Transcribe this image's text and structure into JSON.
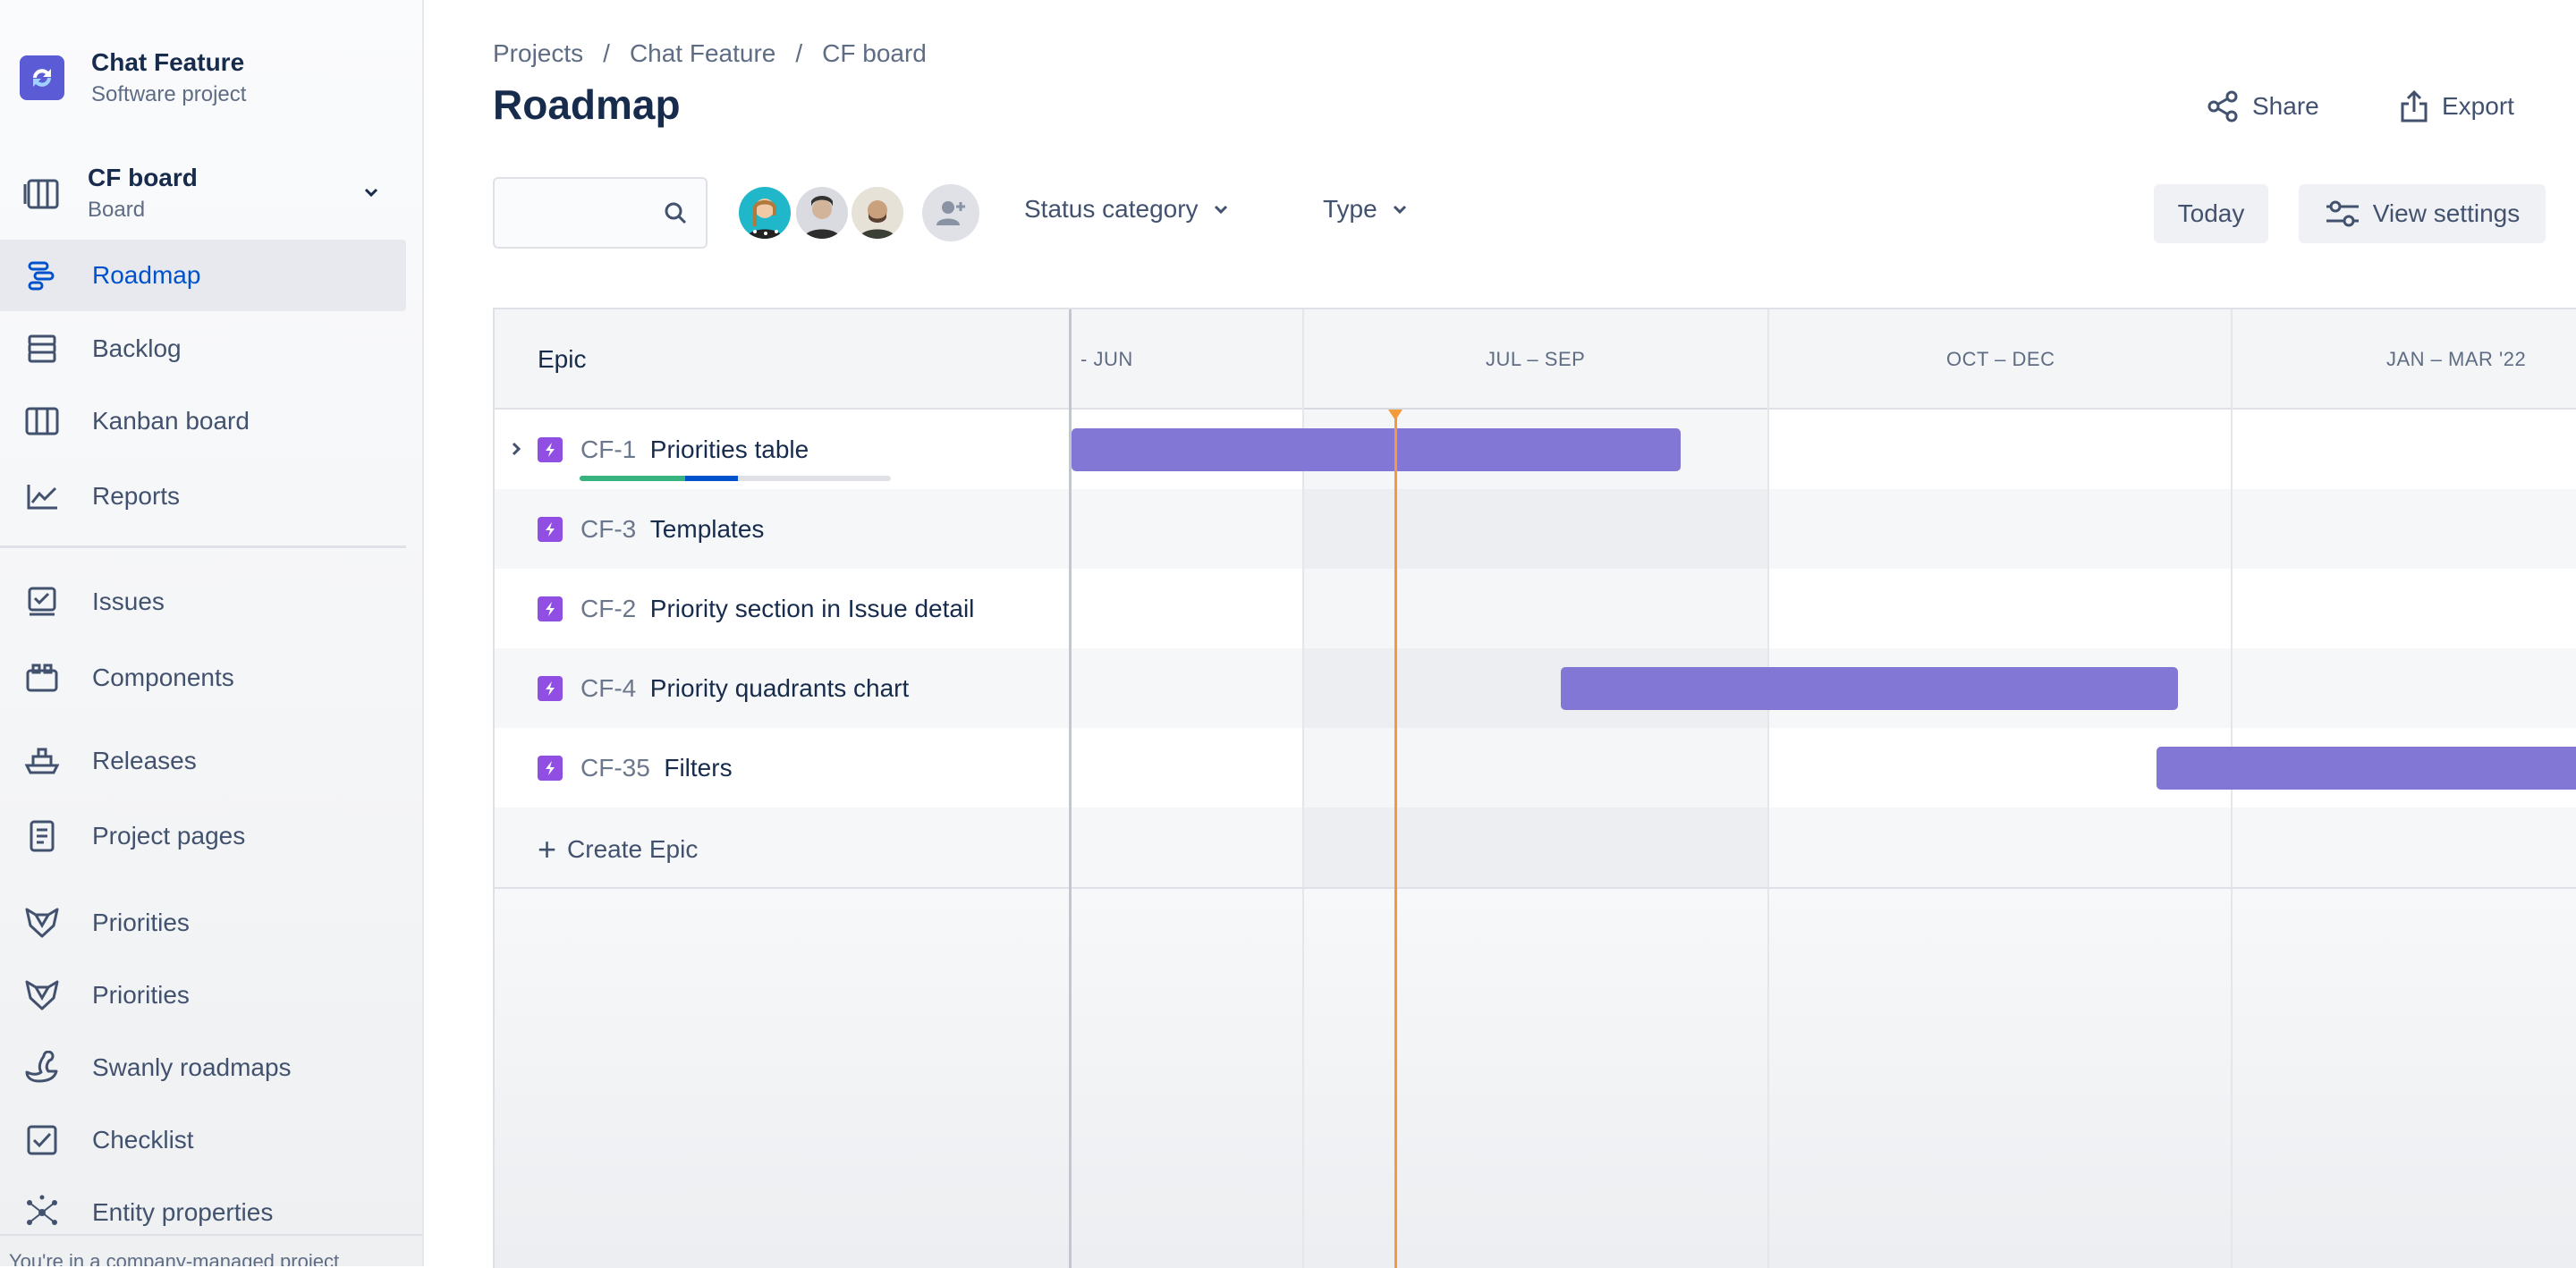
{
  "project": {
    "name": "Chat Feature",
    "type": "Software project"
  },
  "board": {
    "name": "CF board",
    "type": "Board"
  },
  "sidebar": {
    "items": [
      {
        "label": "Roadmap",
        "icon": "roadmap-icon",
        "active": true
      },
      {
        "label": "Backlog",
        "icon": "backlog-icon"
      },
      {
        "label": "Kanban board",
        "icon": "kanban-icon"
      },
      {
        "label": "Reports",
        "icon": "reports-icon"
      },
      {
        "label": "Issues",
        "icon": "issues-icon"
      },
      {
        "label": "Components",
        "icon": "components-icon"
      },
      {
        "label": "Releases",
        "icon": "releases-icon"
      },
      {
        "label": "Project pages",
        "icon": "page-icon"
      },
      {
        "label": "Priorities",
        "icon": "fox-icon"
      },
      {
        "label": "Priorities",
        "icon": "fox-icon"
      },
      {
        "label": "Swanly roadmaps",
        "icon": "swan-icon"
      },
      {
        "label": "Checklist",
        "icon": "checklist-icon"
      },
      {
        "label": "Entity properties",
        "icon": "network-icon"
      }
    ],
    "footer": "You're in a company-managed project"
  },
  "breadcrumb": [
    "Projects",
    "Chat Feature",
    "CF board"
  ],
  "page_title": "Roadmap",
  "header_actions": {
    "share": "Share",
    "export": "Export"
  },
  "toolbar": {
    "search_placeholder": "",
    "status_filter": "Status category",
    "type_filter": "Type",
    "today": "Today",
    "view_settings": "View settings"
  },
  "roadmap": {
    "column_header": "Epic",
    "periods": [
      "- JUN",
      "JUL – SEP",
      "OCT – DEC",
      "JAN – MAR '22"
    ],
    "epics": [
      {
        "key": "CF-1",
        "title": "Priorities table",
        "has_children": true,
        "progress_done": 0.34,
        "progress_in_progress": 0.17
      },
      {
        "key": "CF-3",
        "title": "Templates"
      },
      {
        "key": "CF-2",
        "title": "Priority section in Issue detail"
      },
      {
        "key": "CF-4",
        "title": "Priority quadrants chart"
      },
      {
        "key": "CF-35",
        "title": "Filters"
      }
    ],
    "create_label": "Create Epic"
  },
  "colors": {
    "accent": "#0052cc",
    "epic": "#904ee2",
    "bar": "#8277d4",
    "today": "#f29b3c",
    "done": "#36b37e",
    "in_progress": "#0052cc"
  }
}
